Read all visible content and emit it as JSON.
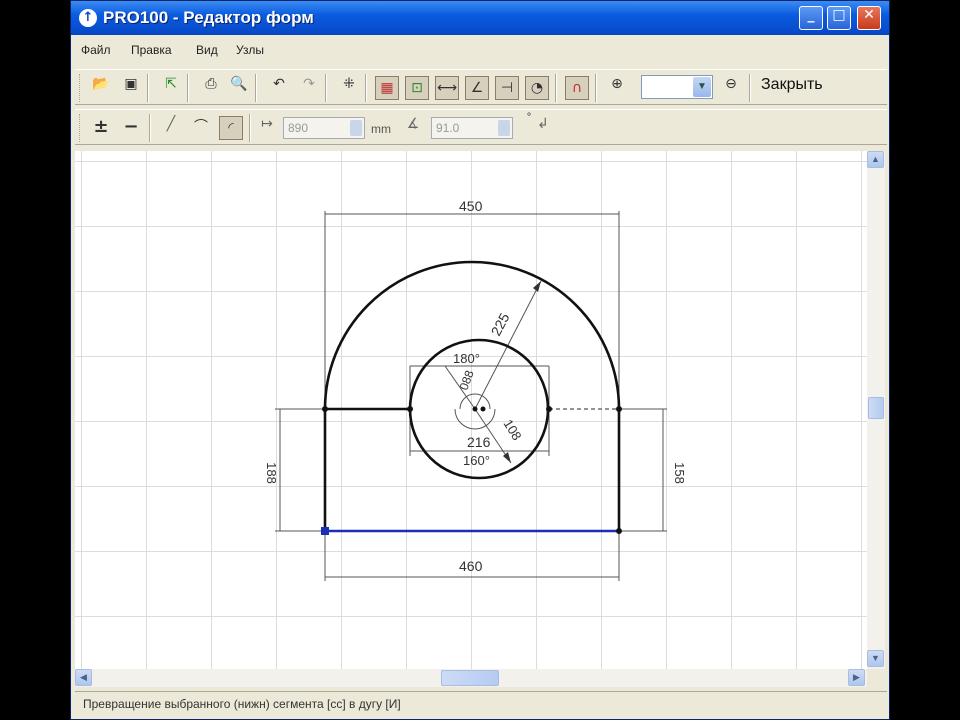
{
  "window": {
    "app_icon": "info-arrow-icon",
    "title": "PRO100 - Редактор форм",
    "buttons": [
      "minimize",
      "maximize",
      "close"
    ]
  },
  "menu": [
    "Файл",
    "Правка",
    "Вид",
    "Узлы"
  ],
  "toolbar1": {
    "close_label": "Закрыть",
    "zoom_value": ""
  },
  "toolbar2": {
    "length_value": "890",
    "unit": "mm",
    "angle_value": "91.0"
  },
  "drawing": {
    "dim_top": "450",
    "dim_bottom": "460",
    "dim_left": "188",
    "dim_right": "158",
    "dim_inner_width": "216",
    "dim_radius_large": "225",
    "dim_radius_small": "108",
    "dim_angle_top": "180°",
    "dim_angle_bottom": "160°",
    "dim_small_label": "088"
  },
  "status": {
    "text": "Превращение выбранного (нижн) сегмента [сс] в дугу [И]"
  }
}
